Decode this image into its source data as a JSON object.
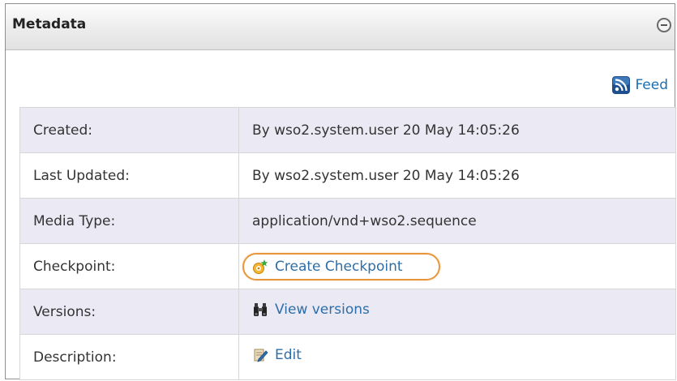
{
  "panel": {
    "title": "Metadata"
  },
  "feed": {
    "label": "Feed",
    "icon": "rss-feed-icon"
  },
  "rows": [
    {
      "key": "Created:",
      "value": "By wso2.system.user 20 May 14:05:26"
    },
    {
      "key": "Last Updated:",
      "value": "By wso2.system.user 20 May 14:05:26"
    },
    {
      "key": "Media Type:",
      "value": "application/vnd+wso2.sequence"
    },
    {
      "key": "Checkpoint:",
      "link": "Create Checkpoint",
      "icon": "checkpoint-icon"
    },
    {
      "key": "Versions:",
      "link": "View versions",
      "icon": "binoculars-icon"
    },
    {
      "key": "Description:",
      "link": "Edit",
      "icon": "edit-icon"
    }
  ],
  "colors": {
    "row_shade": "#ebe9f4",
    "link": "#2d6ea8",
    "highlight": "#e8963c"
  }
}
